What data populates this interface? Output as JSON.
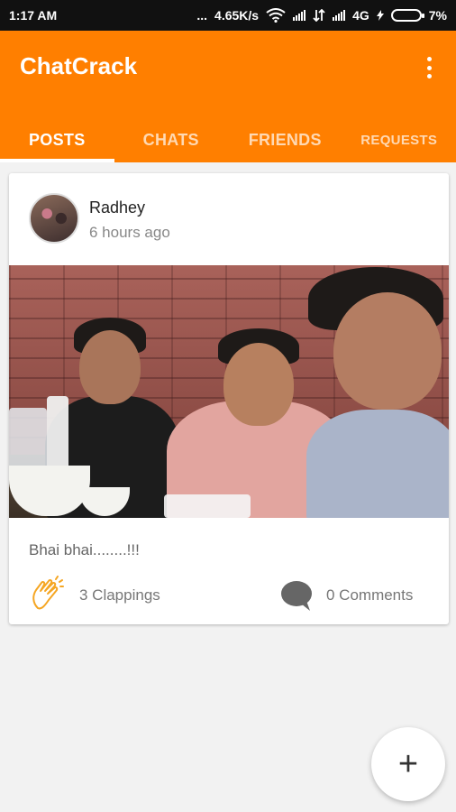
{
  "status": {
    "time": "1:17 AM",
    "dots": "...",
    "speed": "4.65K/s",
    "network": "4G",
    "battery": "7%"
  },
  "app": {
    "title": "ChatCrack",
    "overflow_icon": "more-vert-icon"
  },
  "tabs": [
    {
      "label": "POSTS",
      "active": true
    },
    {
      "label": "CHATS",
      "active": false
    },
    {
      "label": "FRIENDS",
      "active": false
    },
    {
      "label": "REQUESTS",
      "active": false
    }
  ],
  "post": {
    "author": "Radhey",
    "time": "6 hours ago",
    "caption": "Bhai bhai........!!!",
    "clappings": "3 Clappings",
    "comments": "0 Comments"
  },
  "fab": {
    "icon": "add-icon",
    "label": "+"
  },
  "colors": {
    "accent": "#ff7f00",
    "status_bar": "#111111",
    "background": "#f2f2f2"
  }
}
